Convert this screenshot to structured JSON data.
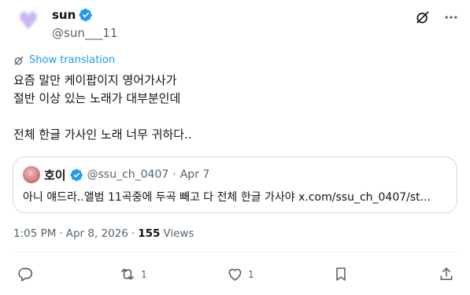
{
  "author": {
    "display_name": "sun",
    "handle": "@sun___11",
    "verified": true,
    "avatar_icon": "purple-heart"
  },
  "translate": {
    "label": "Show translation"
  },
  "tweet": {
    "lines": [
      "요즘 말만 케이팝이지 영어가사가",
      "절반 이상 있는 노래가 대부분인데",
      "",
      "전체 한글 가사인 노래 너무 귀하다.."
    ]
  },
  "quote": {
    "display_name": "호이",
    "verified": true,
    "handle": "@ssu_ch_0407",
    "separator": "·",
    "date": "Apr 7",
    "text": "아니 얘드라..앨범 11곡중에 두곡 빼고 다 전체 한글 가사야 x.com/ssu_ch_0407/st..."
  },
  "meta": {
    "time": "1:05 PM",
    "separator": "·",
    "date": "Apr 8, 2026",
    "separator2": "·",
    "views_count": "155",
    "views_label": "Views"
  },
  "actions": {
    "reply_count": "",
    "retweet_count": "1",
    "like_count": "1"
  },
  "icons": [
    "grok-icon",
    "more-icon",
    "translate-icon",
    "verified-icon",
    "reply-icon",
    "retweet-icon",
    "like-icon",
    "bookmark-icon",
    "share-icon"
  ],
  "colors": {
    "accent": "#1d9bf0",
    "secondary_text": "#536471",
    "border": "#cfd9de"
  }
}
